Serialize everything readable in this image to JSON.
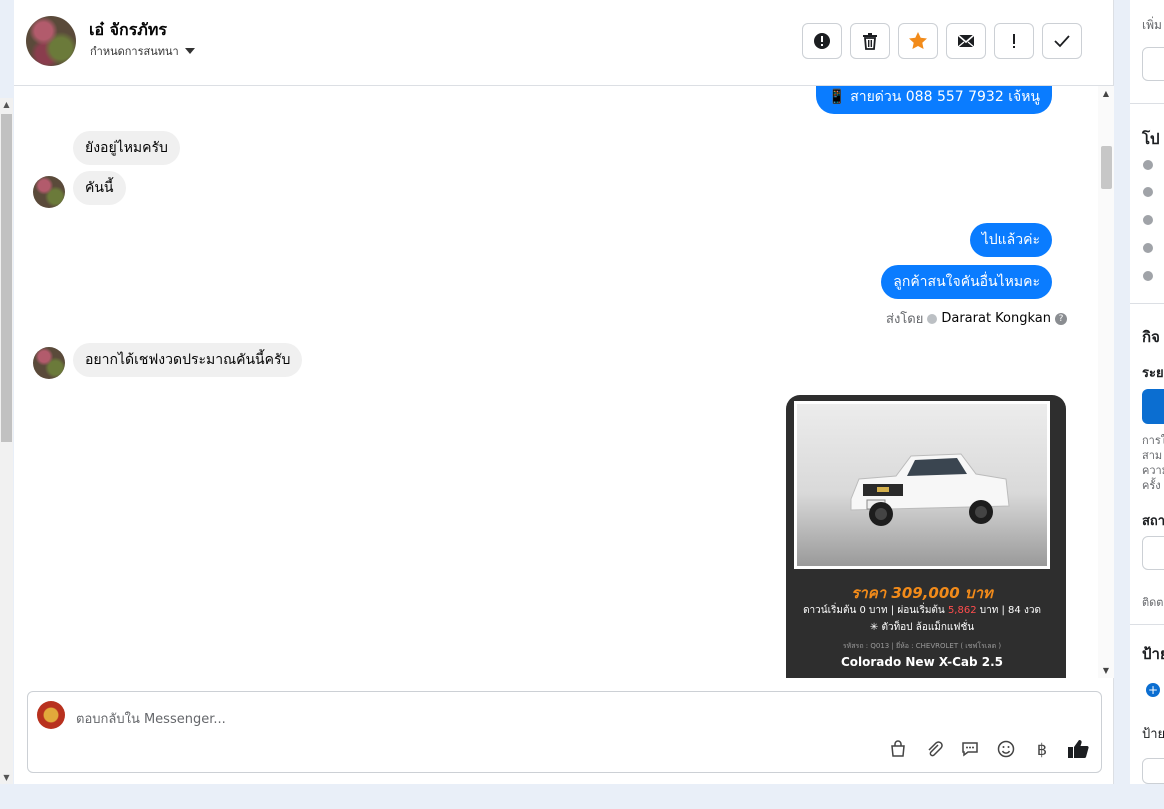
{
  "header": {
    "contact_name": "เอ๋ จักรภัทร",
    "assign_label": "กำหนดการสนทนา"
  },
  "header_actions": [
    "alert-circle-icon",
    "trash-icon",
    "star-icon",
    "envelope-icon",
    "exclamation-icon",
    "check-icon"
  ],
  "messages": {
    "m1": "📱 สายด่วน 088 557 7932 เจ้หนู",
    "m2": "ยังอยู่ไหมครับ",
    "m3": "คันนี้",
    "m4": "ไปแล้วค่ะ",
    "m5": "ลูกค้าสนใจคันอื่นไหมคะ",
    "m6": "อยากได้เชฟงวดประมาณคันนี้ครับ"
  },
  "sent_by": {
    "prefix": "ส่งโดย",
    "name": "Dararat Kongkan"
  },
  "car_card": {
    "price": "ราคา 309,000 บาท",
    "down_a": "ดาวน์เริ่มต้น 0 บาท | ผ่อนเริ่มต้น ",
    "installment": "5,862",
    "down_b": " บาท | 84 งวด",
    "feature": "✳ ตัวท็อป ล้อแม็กแฟชั่น",
    "code": "รหัสรถ : Q013 | ยี่ห้อ : CHEVROLET ( เชฟโรเลต )",
    "model": "Colorado New X-Cab 2.5"
  },
  "composer": {
    "placeholder": "ตอบกลับใน Messenger..."
  },
  "composer_tools": [
    "bag-icon",
    "paperclip-icon",
    "chat-icon",
    "emoji-icon",
    "baht-icon",
    "thumbs-up-icon"
  ],
  "sidebar": {
    "t1": "เพิ่ม",
    "t2": "โป",
    "t3": "กิจ",
    "t4": "ระย",
    "t5": "การใ",
    "t6": "สาม",
    "t7": "ความ",
    "t8": "ครั้ง",
    "t9": "สถา",
    "t10": "ติดต",
    "t11": "ป้าย",
    "t12": "ป้าย"
  },
  "colors": {
    "outgoing": "#0a7cff",
    "incoming": "#f0f0f0",
    "price": "#f28b1a",
    "star": "#f28b1a"
  }
}
